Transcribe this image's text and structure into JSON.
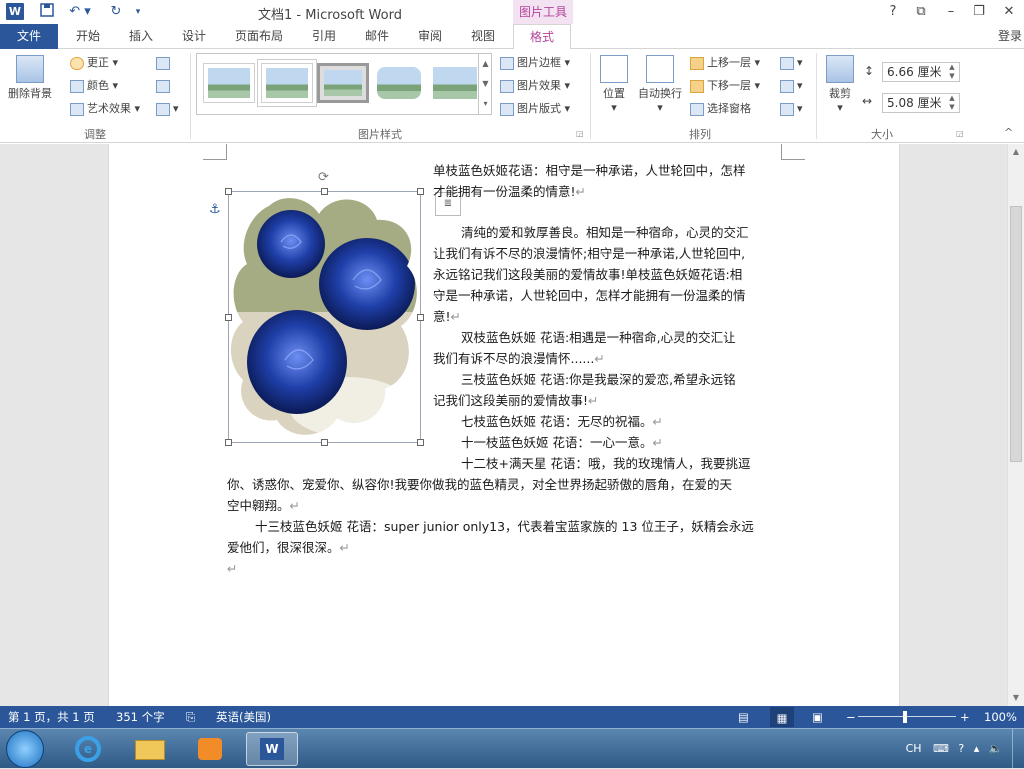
{
  "window": {
    "title": "文档1 - Microsoft Word",
    "picture_tools": "图片工具",
    "login": "登录",
    "help": "?",
    "controls": [
      "?",
      "⧉",
      "–",
      "❐",
      "✕"
    ]
  },
  "tabs": [
    "文件",
    "开始",
    "插入",
    "设计",
    "页面布局",
    "引用",
    "邮件",
    "审阅",
    "视图",
    "格式"
  ],
  "ribbon": {
    "adjust": {
      "remove_bg": "删除背景",
      "correct": "更正 ▾",
      "color": "颜色 ▾",
      "art_effects": "艺术效果 ▾",
      "label": "调整"
    },
    "styles": {
      "border": "图片边框 ▾",
      "effects": "图片效果 ▾",
      "layout": "图片版式 ▾",
      "label": "图片样式"
    },
    "arrange": {
      "position": "位置",
      "wrap": "自动换行",
      "bring_forward": "上移一层 ▾",
      "send_backward": "下移一层 ▾",
      "selection_pane": "选择窗格",
      "label": "排列"
    },
    "size": {
      "crop": "裁剪",
      "height": "6.66 厘米",
      "width": "5.08 厘米",
      "label": "大小"
    }
  },
  "document": {
    "lines": [
      "单枝蓝色妖姬花语：相守是一种承诺，人世轮回中，怎样",
      "才能拥有一份温柔的情意!",
      "清纯的爱和敦厚善良。相知是一种宿命，心灵的交汇",
      "让我们有诉不尽的浪漫情怀;相守是一种承诺,人世轮回中,",
      "永远铭记我们这段美丽的爱情故事!单枝蓝色妖姬花语:相",
      "守是一种承诺，人世轮回中，怎样才能拥有一份温柔的情",
      "意!",
      "双枝蓝色妖姬  花语:相遇是一种宿命,心灵的交汇让",
      "我们有诉不尽的浪漫情怀......",
      "三枝蓝色妖姬  花语:你是我最深的爱恋,希望永远铭",
      "记我们这段美丽的爱情故事!",
      "七枝蓝色妖姬  花语：无尽的祝福。",
      "十一枝蓝色妖姬  花语：一心一意。",
      "十二枝+满天星  花语：哦，我的玫瑰情人，我要挑逗",
      "你、诱惑你、宠爱你、纵容你!我要你做我的蓝色精灵，对全世界扬起骄傲的唇角，在爱的天",
      "空中翱翔。",
      "十三枝蓝色妖姬  花语：super junior only13，代表着宝蓝家族的 13 位王子，妖精会永远",
      "爱他们，很深很深。"
    ],
    "pilcrow": "↵"
  },
  "statusbar": {
    "page": "第 1 页，共 1 页",
    "words": "351 个字",
    "lang": "英语(美国)",
    "zoom": "100%",
    "minus": "−",
    "plus": "+"
  },
  "taskbar": {
    "ime": "CH"
  },
  "colors": {
    "word_blue": "#2b579a",
    "picture_tools_pink": "#b4439d",
    "rose_blue": "#1f3fa8"
  }
}
